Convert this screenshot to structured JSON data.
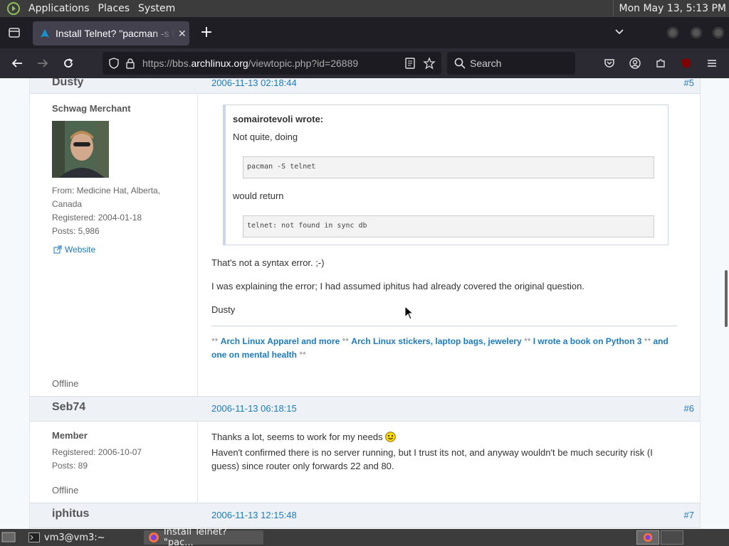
{
  "panel": {
    "menus": [
      "Applications",
      "Places",
      "System"
    ],
    "clock": "Mon May 13,  5:13 PM"
  },
  "browser": {
    "tab_title": "Install Telnet? \"pacman -s te",
    "url_host_prefix": "https://bbs.",
    "url_host": "archlinux.org",
    "url_path": "/viewtopic.php?id=26889",
    "search_placeholder": "Search"
  },
  "posts": [
    {
      "author": "Dusty",
      "date": "2006-11-13 02:18:44",
      "number": "#5",
      "rank": "Schwag Merchant",
      "info": [
        "From: Medicine Hat, Alberta,",
        "Canada",
        "Registered: 2004-01-18",
        "Posts: 5,986"
      ],
      "website": "Website",
      "status": "Offline",
      "quote": {
        "header": "somairotevoli wrote:",
        "line1": "Not quite, doing",
        "code1": "pacman -S telnet",
        "line2": "would return",
        "code2": "telnet: not found in sync db"
      },
      "paragraphs": [
        "That's not a syntax error. ;-)",
        "I was explaining the error; I had assumed iphitus had already covered the original question.",
        "Dusty"
      ],
      "signature": {
        "sep": "**",
        "link1": "Arch Linux Apparel and more",
        "link2": "Arch Linux stickers, laptop bags, jewelery",
        "link3": "I wrote a book on Python 3",
        "link4": "and one on mental health"
      }
    },
    {
      "author": "Seb74",
      "date": "2006-11-13 06:18:15",
      "number": "#6",
      "rank": "Member",
      "info": [
        "Registered: 2006-10-07",
        "Posts: 89"
      ],
      "status": "Offline",
      "line1": "Thanks a lot, seems to work for my needs",
      "line2": "Haven't confirmed there is no server running, but I trust its not, and anyway wouldn't be much security risk (I",
      "line3": "guess) since router only forwards 22 and 80."
    },
    {
      "author": "iphitus",
      "date": "2006-11-13 12:15:48",
      "number": "#7"
    }
  ],
  "taskbar": {
    "terminal": "vm3@vm3:~",
    "firefox": "Install Telnet? \"pac..."
  }
}
